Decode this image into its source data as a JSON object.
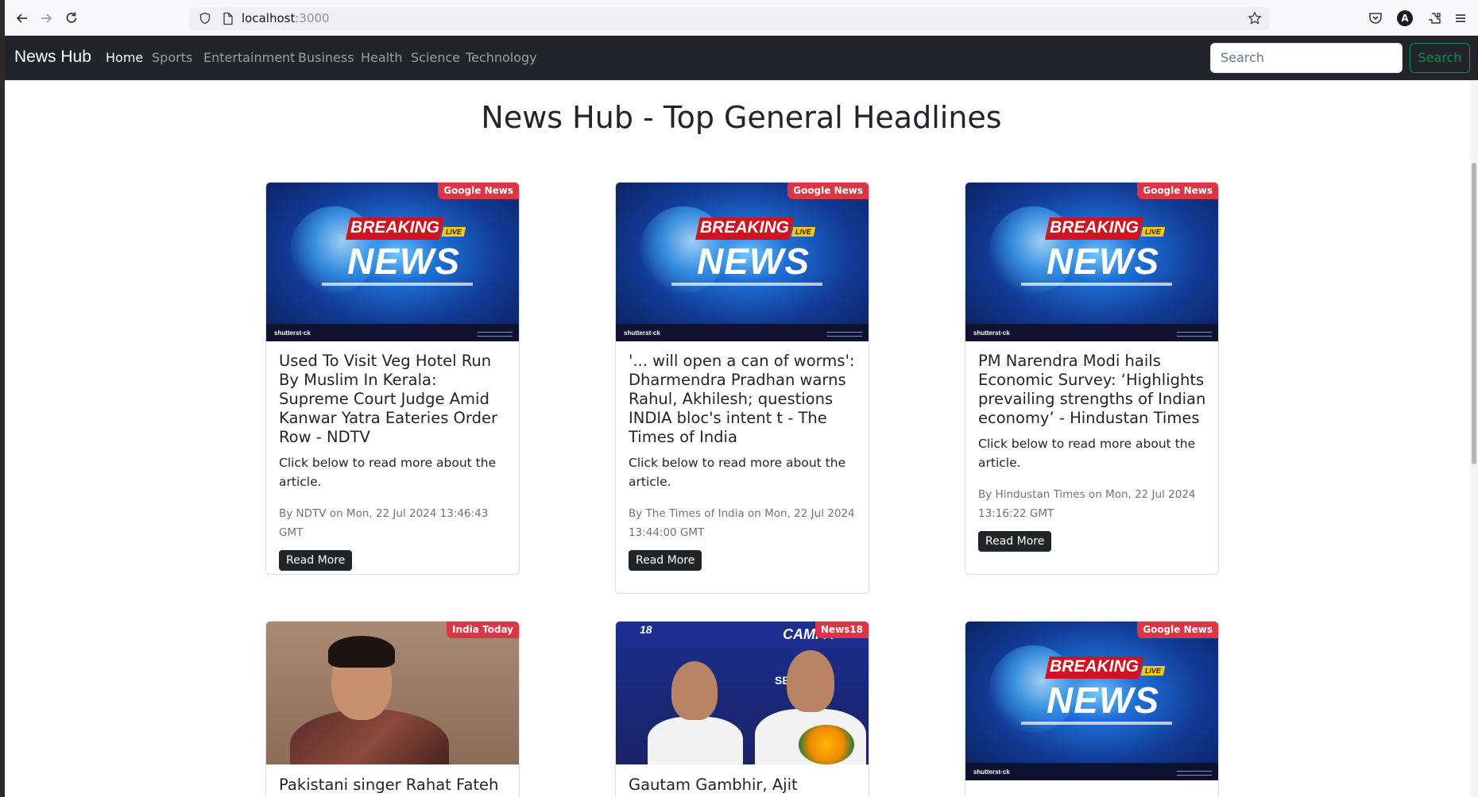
{
  "browser": {
    "url_host": "localhost",
    "url_port": ":3000",
    "profile_initial": "A"
  },
  "navbar": {
    "brand": "News Hub",
    "links": [
      "Home",
      "Sports",
      "Entertainment",
      "Business",
      "Health",
      "Science",
      "Technology"
    ],
    "active": "Home",
    "search_placeholder": "Search",
    "search_button": "Search"
  },
  "page": {
    "headline": "News Hub - Top General Headlines"
  },
  "images": {
    "breaking_top": "BREAKING",
    "breaking_live": "LIVE",
    "breaking_main": "NEWS",
    "watermark": "shutterst·ck"
  },
  "articles": [
    {
      "source": "Google News",
      "title": "Used To Visit Veg Hotel Run By Muslim In Kerala: Supreme Court Judge Amid Kanwar Yatra Eateries Order Row - NDTV",
      "text": "Click below to read more about the article.",
      "meta": "By NDTV on Mon, 22 Jul 2024 13:46:43 GMT",
      "button": "Read More",
      "image": "breaking-news"
    },
    {
      "source": "Google News",
      "title": "'... will open a can of worms': Dharmendra Pradhan warns Rahul, Akhilesh; questions INDIA bloc's intent t - The Times of India",
      "text": "Click below to read more about the article.",
      "meta": "By The Times of India on Mon, 22 Jul 2024 13:44:00 GMT",
      "button": "Read More",
      "image": "breaking-news"
    },
    {
      "source": "Google News",
      "title": "PM Narendra Modi hails Economic Survey: ‘Highlights prevailing strengths of Indian economy’ - Hindustan Times",
      "text": "Click below to read more about the article.",
      "meta": "By Hindustan Times on Mon, 22 Jul 2024 13:16:22 GMT",
      "button": "Read More",
      "image": "breaking-news"
    },
    {
      "source": "India Today",
      "title": "Pakistani singer Rahat Fateh",
      "image": "portrait"
    },
    {
      "source": "News18",
      "title": "Gautam Gambhir, Ajit Agarkar",
      "image": "press-conference"
    },
    {
      "source": "Google News",
      "title": "",
      "image": "breaking-news"
    }
  ],
  "colors": {
    "navbar_bg": "#212529",
    "badge": "#dc3545",
    "search_outline": "#198754"
  }
}
